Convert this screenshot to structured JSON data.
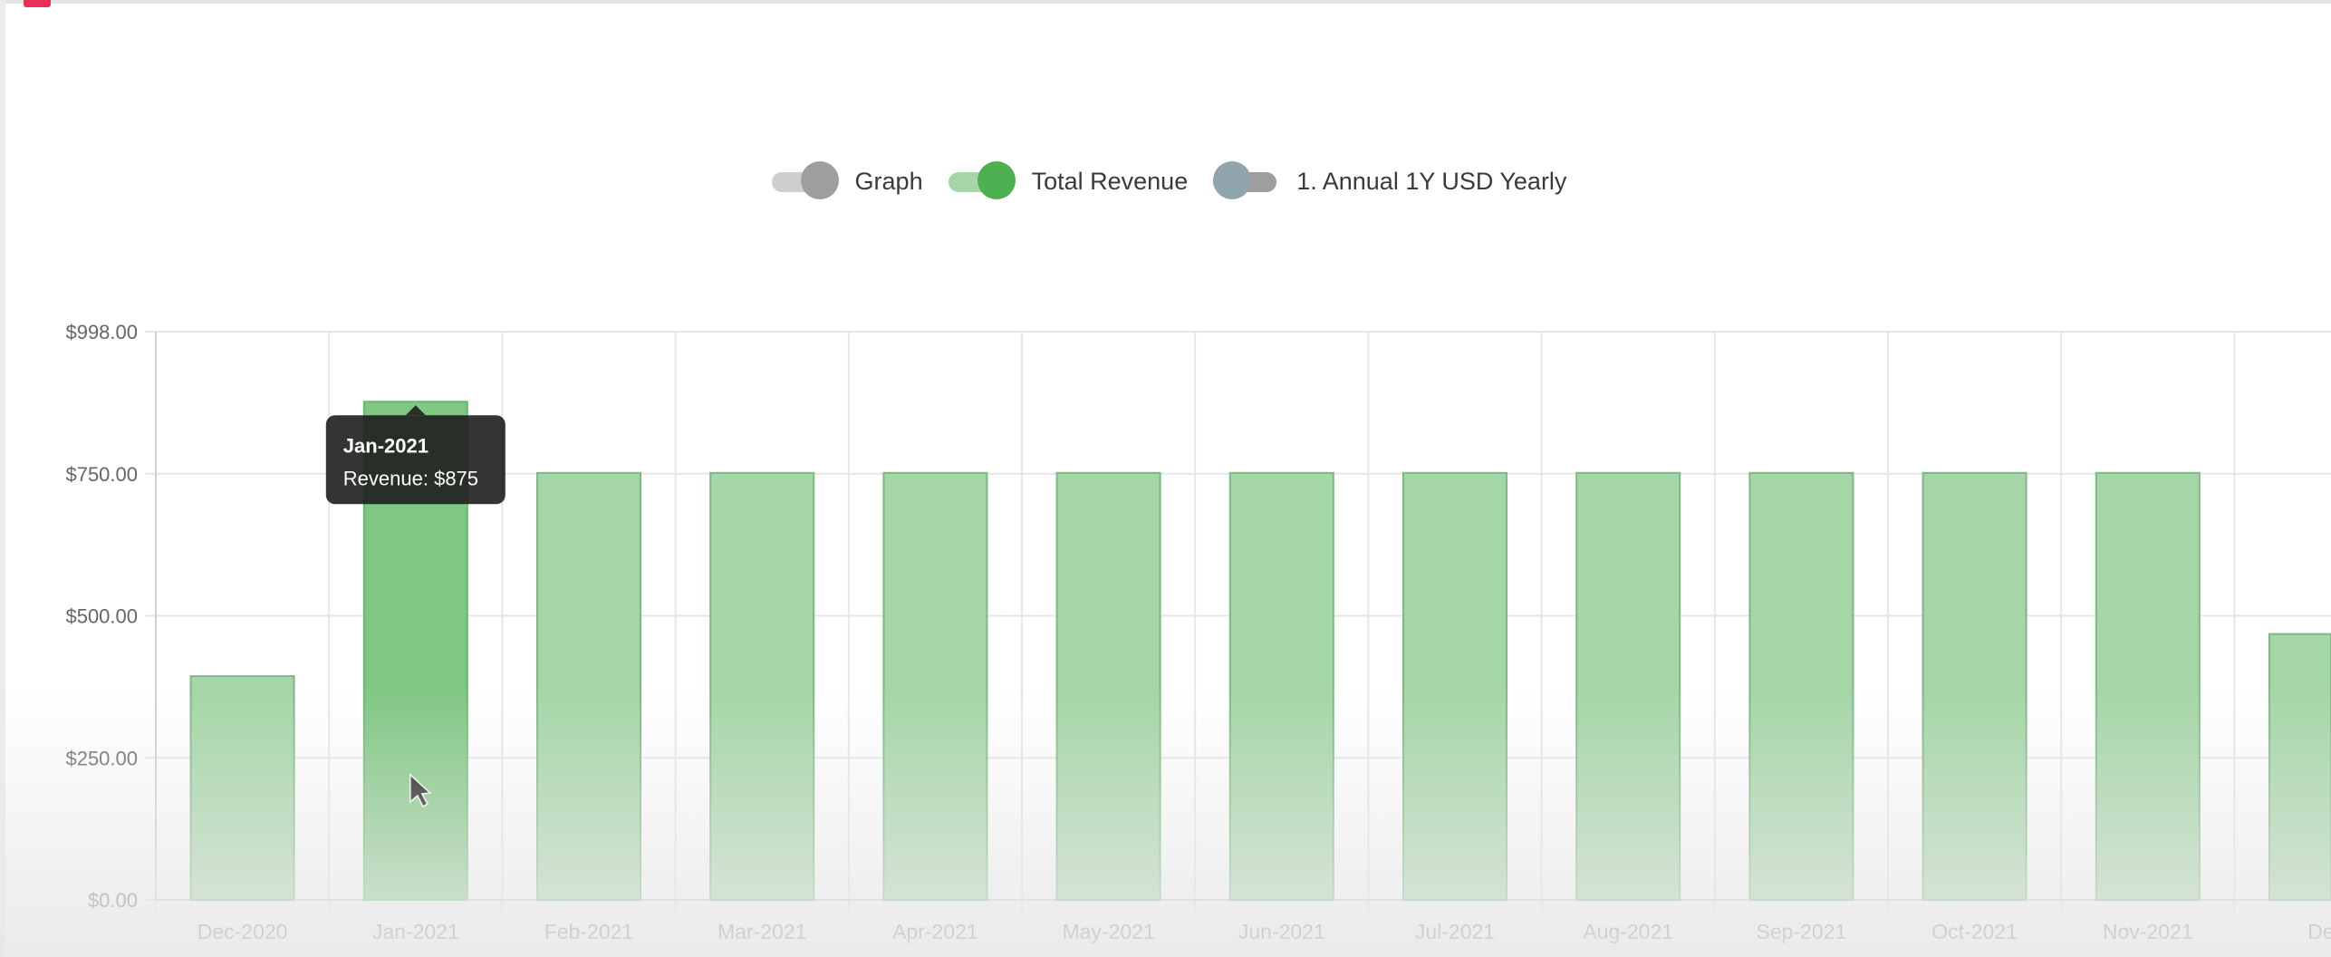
{
  "legend": {
    "items": [
      {
        "label": "Graph",
        "state": "on",
        "track_color": "#cfcfcf",
        "knob_color": "#9e9e9e"
      },
      {
        "label": "Total Revenue",
        "state": "on",
        "track_color": "#a5d6a7",
        "knob_color": "#4caf50"
      },
      {
        "label": "1. Annual 1Y USD Yearly",
        "state": "off",
        "track_color": "#9e9e9e",
        "knob_color": "#90a4ae"
      }
    ]
  },
  "tooltip": {
    "title": "Jan-2021",
    "body": "Revenue: $875"
  },
  "colors": {
    "bar_fill": "#a5d6a7",
    "bar_stroke": "#7cb983",
    "bar_active_fill": "#81c784",
    "bar_active_stroke": "#66bb6a",
    "grid": "#e6e6e6",
    "tooltip_bg": "#1e1e1e"
  },
  "chart_data": {
    "type": "bar",
    "categories": [
      "Dec-2020",
      "Jan-2021",
      "Feb-2021",
      "Mar-2021",
      "Apr-2021",
      "May-2021",
      "Jun-2021",
      "Jul-2021",
      "Aug-2021",
      "Sep-2021",
      "Oct-2021",
      "Nov-2021",
      "De"
    ],
    "series": [
      {
        "name": "Total Revenue",
        "values": [
          393,
          875,
          750,
          750,
          750,
          750,
          750,
          750,
          750,
          750,
          750,
          750,
          467
        ]
      }
    ],
    "ylim": [
      0,
      998
    ],
    "yticks": [
      {
        "value": 0,
        "label": "$0.00"
      },
      {
        "value": 249.5,
        "label": "$250.00"
      },
      {
        "value": 499,
        "label": "$500.00"
      },
      {
        "value": 748.5,
        "label": "$750.00"
      },
      {
        "value": 998,
        "label": "$998.00"
      }
    ],
    "highlighted_category": "Jan-2021",
    "grid": true
  }
}
